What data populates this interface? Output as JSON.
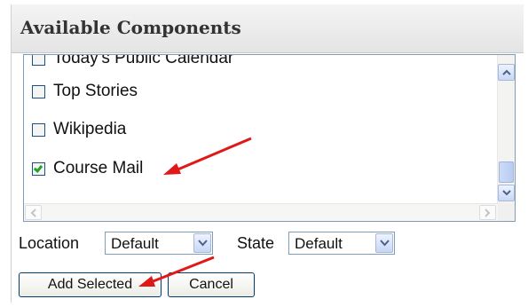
{
  "panel": {
    "title": "Available Components"
  },
  "list": {
    "items": [
      {
        "label": "Today's Public Calendar",
        "checked": false
      },
      {
        "label": "Top Stories",
        "checked": false
      },
      {
        "label": "Wikipedia",
        "checked": false
      },
      {
        "label": "Course Mail",
        "checked": true
      }
    ]
  },
  "controls": {
    "location_label": "Location",
    "location_value": "Default",
    "state_label": "State",
    "state_value": "Default"
  },
  "buttons": {
    "add_selected": "Add Selected",
    "cancel": "Cancel"
  },
  "colors": {
    "annotation_arrow": "#e01818",
    "checkmark": "#22a322"
  }
}
